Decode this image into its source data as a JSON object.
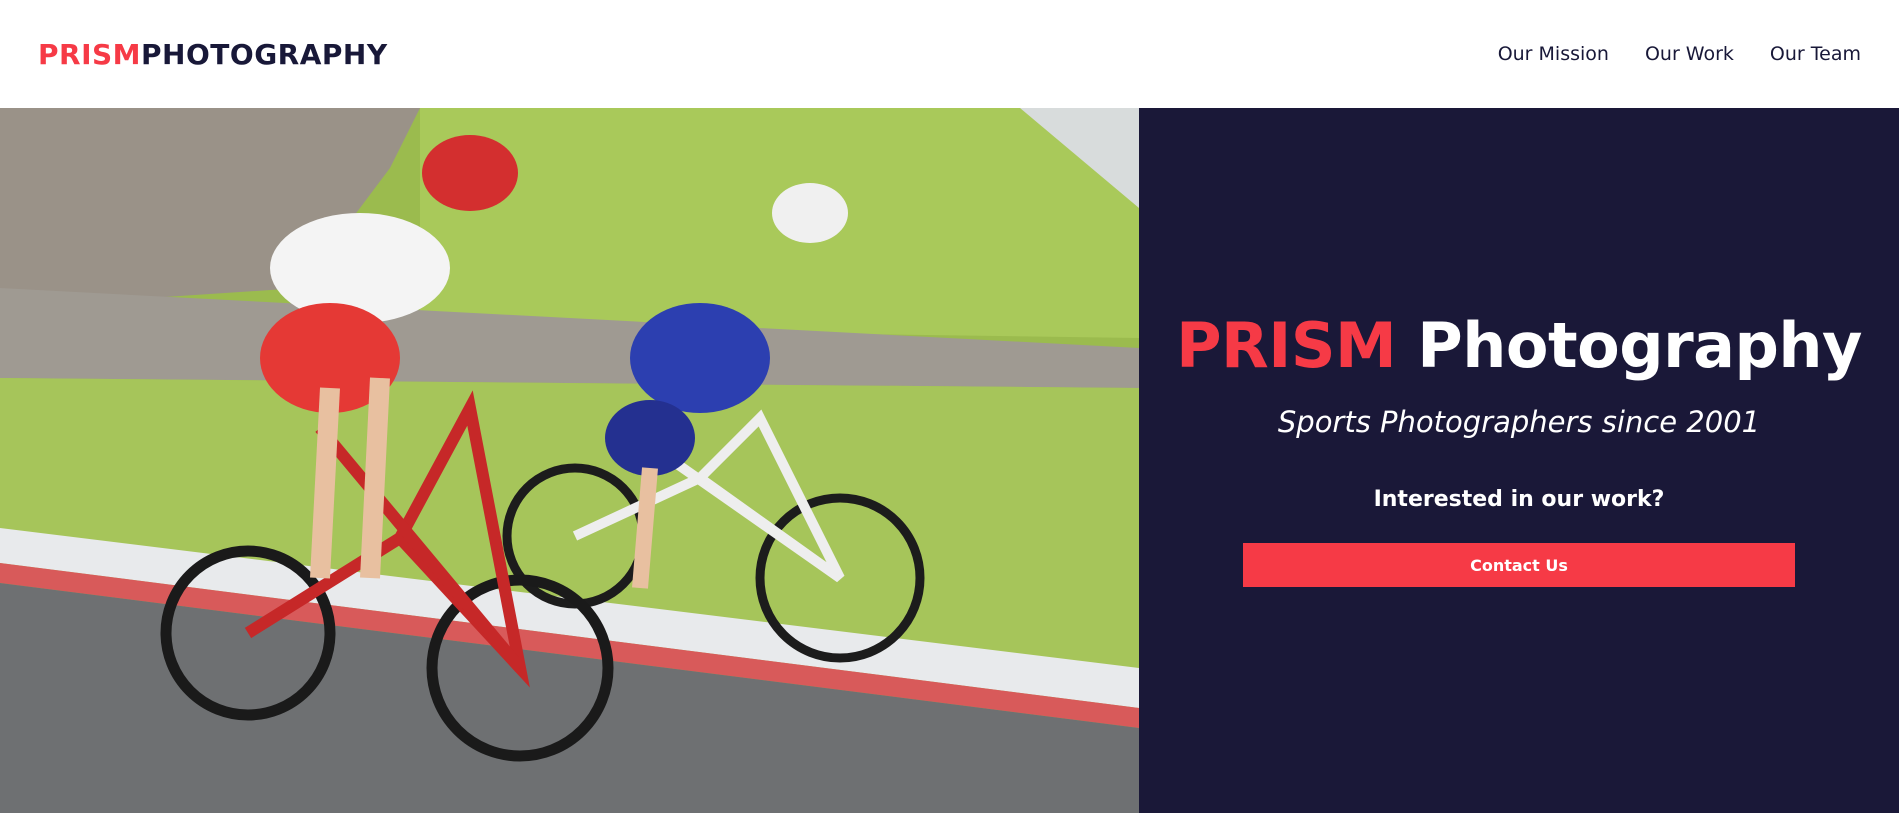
{
  "brand": {
    "logo_accent": "PRISM",
    "logo_main": "PHOTOGRAPHY",
    "accent_color": "#f63a46",
    "dark_color": "#1a1838"
  },
  "nav": {
    "items": [
      {
        "label": "Our Mission"
      },
      {
        "label": "Our Work"
      },
      {
        "label": "Our Team"
      }
    ]
  },
  "hero": {
    "image_subject": "cyclists-photo",
    "title_accent": "PRISM",
    "title_main": "Photography",
    "subtitle": "Sports Photographers since 2001",
    "question": "Interested in our work?",
    "cta_label": "Contact Us"
  }
}
